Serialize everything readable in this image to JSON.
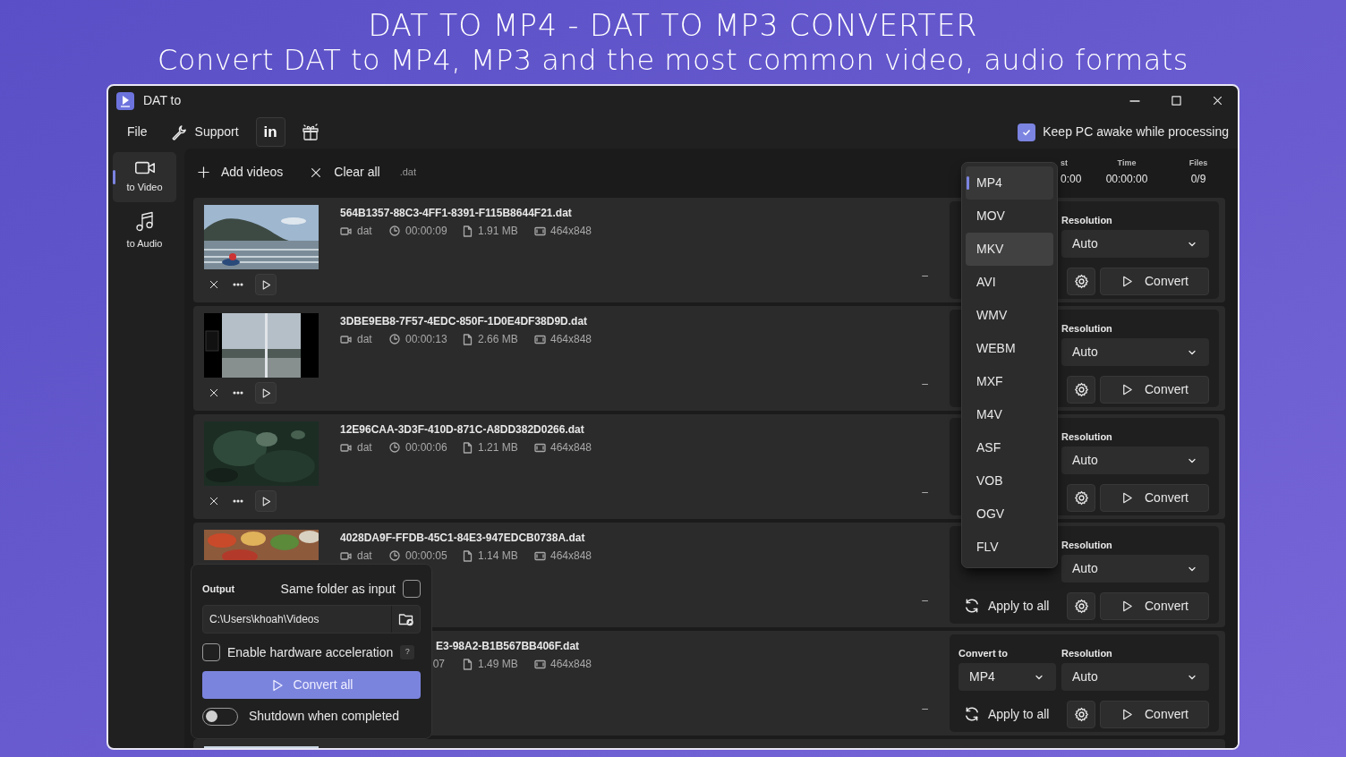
{
  "header": {
    "title": "DAT TO MP4 - DAT TO MP3 CONVERTER",
    "subtitle": "Convert DAT to MP4, MP3 and the most common video, audio formats"
  },
  "window": {
    "title": "DAT to"
  },
  "menu": {
    "file": "File",
    "support": "Support",
    "linkedin": "in",
    "keep_awake": {
      "label": "Keep PC awake while processing",
      "checked": true
    }
  },
  "sidebar": {
    "items": [
      {
        "label": "to Video",
        "kind": "video",
        "selected": true
      },
      {
        "label": "to Audio",
        "kind": "audio",
        "selected": false
      }
    ]
  },
  "toolbar": {
    "add": "Add videos",
    "clear": "Clear all",
    "filter": ".dat"
  },
  "stats": [
    {
      "label": "st",
      "value": "0:00"
    },
    {
      "label": "Time",
      "value": "00:00:00"
    },
    {
      "label": "Files",
      "value": "0/9"
    }
  ],
  "rows": [
    {
      "kind": "full",
      "name": "564B1357-88C3-4FF1-8391-F115B8644F21.dat",
      "type": "dat",
      "duration": "00:00:09",
      "size": "1.91 MB",
      "resolution": "464x848",
      "status": "–",
      "resolution_label": "Resolution",
      "resolution_value": "Auto",
      "convert": "Convert"
    },
    {
      "kind": "full",
      "name": "3DBE9EB8-7F57-4EDC-850F-1D0E4DF38D9D.dat",
      "type": "dat",
      "duration": "00:00:13",
      "size": "2.66 MB",
      "resolution": "464x848",
      "status": "–",
      "resolution_label": "Resolution",
      "resolution_value": "Auto",
      "convert": "Convert"
    },
    {
      "kind": "full",
      "name": "12E96CAA-3D3F-410D-871C-A8DD382D0266.dat",
      "type": "dat",
      "duration": "00:00:06",
      "size": "1.21 MB",
      "resolution": "464x848",
      "status": "–",
      "resolution_label": "Resolution",
      "resolution_value": "Auto",
      "convert": "Convert"
    },
    {
      "kind": "top_only",
      "name": "4028DA9F-FFDB-45C1-84E3-947EDCB0738A.dat",
      "type": "dat",
      "duration": "00:00:05",
      "size": "1.14 MB",
      "resolution": "464x848",
      "status": "–",
      "apply": "Apply to all",
      "resolution_label": "Resolution",
      "resolution_value": "Auto",
      "convert": "Convert"
    },
    {
      "kind": "under_panel",
      "name": "E3-98A2-B1B567BB406F.dat",
      "duration": "07",
      "size": "1.49 MB",
      "resolution": "464x848",
      "status": "–",
      "convert_to_label": "Convert to",
      "convert_to": "MP4",
      "apply": "Apply to all",
      "resolution_label": "Resolution",
      "resolution_value": "Auto",
      "convert": "Convert"
    },
    {
      "kind": "cut_bottom"
    }
  ],
  "format_menu": {
    "items": [
      {
        "label": "MP4",
        "selected": true,
        "hovered": false
      },
      {
        "label": "MOV",
        "selected": false,
        "hovered": false
      },
      {
        "label": "MKV",
        "selected": false,
        "hovered": true
      },
      {
        "label": "AVI",
        "selected": false,
        "hovered": false
      },
      {
        "label": "WMV",
        "selected": false,
        "hovered": false
      },
      {
        "label": "WEBM",
        "selected": false,
        "hovered": false
      },
      {
        "label": "MXF",
        "selected": false,
        "hovered": false
      },
      {
        "label": "M4V",
        "selected": false,
        "hovered": false
      },
      {
        "label": "ASF",
        "selected": false,
        "hovered": false
      },
      {
        "label": "VOB",
        "selected": false,
        "hovered": false
      },
      {
        "label": "OGV",
        "selected": false,
        "hovered": false
      },
      {
        "label": "FLV",
        "selected": false,
        "hovered": false
      }
    ]
  },
  "output": {
    "label": "Output",
    "same_folder": {
      "label": "Same folder as input",
      "checked": false
    },
    "path": "C:\\Users\\khoah\\Videos",
    "hw_accel": {
      "label": "Enable hardware acceleration",
      "checked": false
    },
    "help": "?",
    "convert_all": "Convert all",
    "shutdown": {
      "label": "Shutdown when completed",
      "on": false
    }
  }
}
